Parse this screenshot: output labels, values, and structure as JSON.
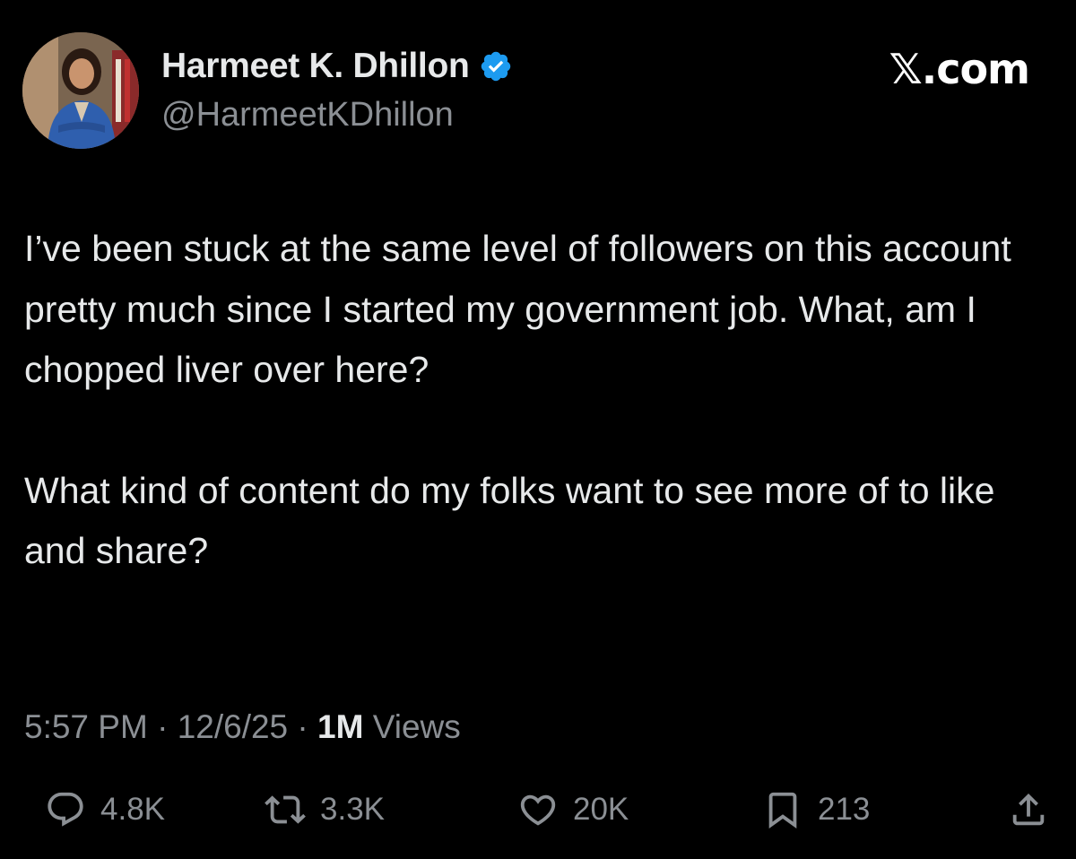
{
  "author": {
    "display_name": "Harmeet K. Dhillon",
    "handle": "@HarmeetKDhillon",
    "verified_icon": "verified-badge-icon",
    "avatar": "profile-photo"
  },
  "brand": "𝕏.com",
  "tweet": {
    "paragraphs": [
      "I’ve been stuck at the same level of followers on this account pretty much since I started my government job. What, am I chopped liver over here?",
      "What kind of content do my folks want to see more of to like and share?"
    ]
  },
  "meta": {
    "time": "5:57 PM",
    "date": "12/6/25",
    "separator": " · ",
    "views_count": "1M",
    "views_label": "Views"
  },
  "actions": {
    "replies": "4.8K",
    "reposts": "3.3K",
    "likes": "20K",
    "bookmarks": "213"
  },
  "colors": {
    "background": "#000000",
    "text": "#e7e9ea",
    "secondary": "#8b8f94",
    "verified": "#1d9bf0"
  }
}
